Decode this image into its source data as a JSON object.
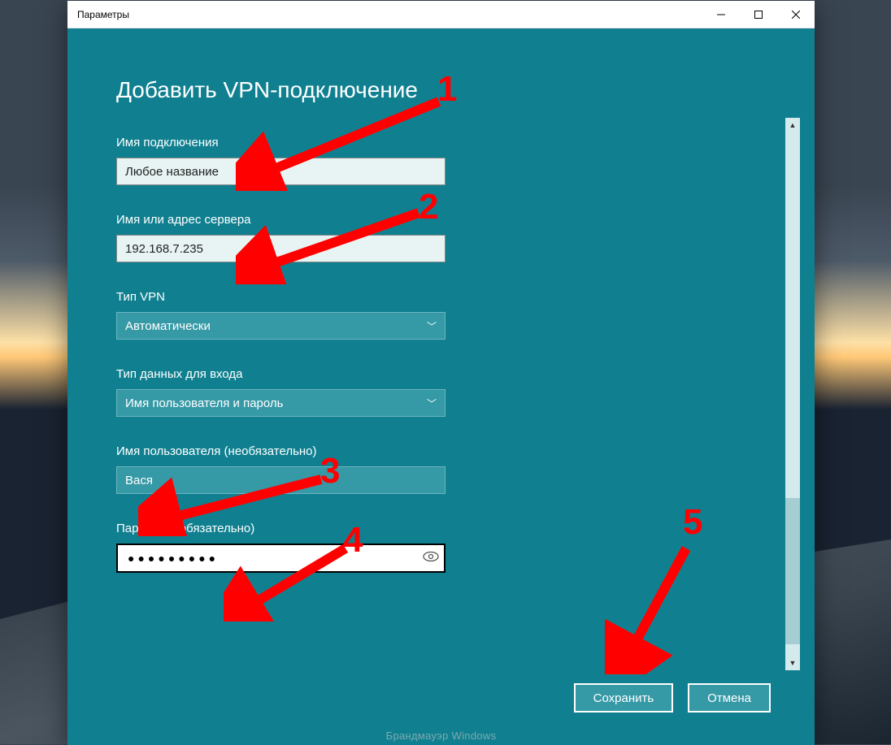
{
  "window": {
    "title": "Параметры"
  },
  "page": {
    "title": "Добавить VPN-подключение",
    "bg_hint": "Брандмауэр Windows"
  },
  "fields": {
    "connection_name": {
      "label": "Имя подключения",
      "value": "Любое название"
    },
    "server_address": {
      "label": "Имя или адрес сервера",
      "value": "192.168.7.235"
    },
    "vpn_type": {
      "label": "Тип VPN",
      "value": "Автоматически"
    },
    "login_type": {
      "label": "Тип данных для входа",
      "value": "Имя пользователя и пароль"
    },
    "username": {
      "label": "Имя пользователя (необязательно)",
      "value": "Вася"
    },
    "password": {
      "label": "Пароль (необязательно)",
      "value": "●●●●●●●●●"
    }
  },
  "buttons": {
    "save": "Сохранить",
    "cancel": "Отмена"
  },
  "annotations": {
    "n1": "1",
    "n2": "2",
    "n3": "3",
    "n4": "4",
    "n5": "5"
  }
}
